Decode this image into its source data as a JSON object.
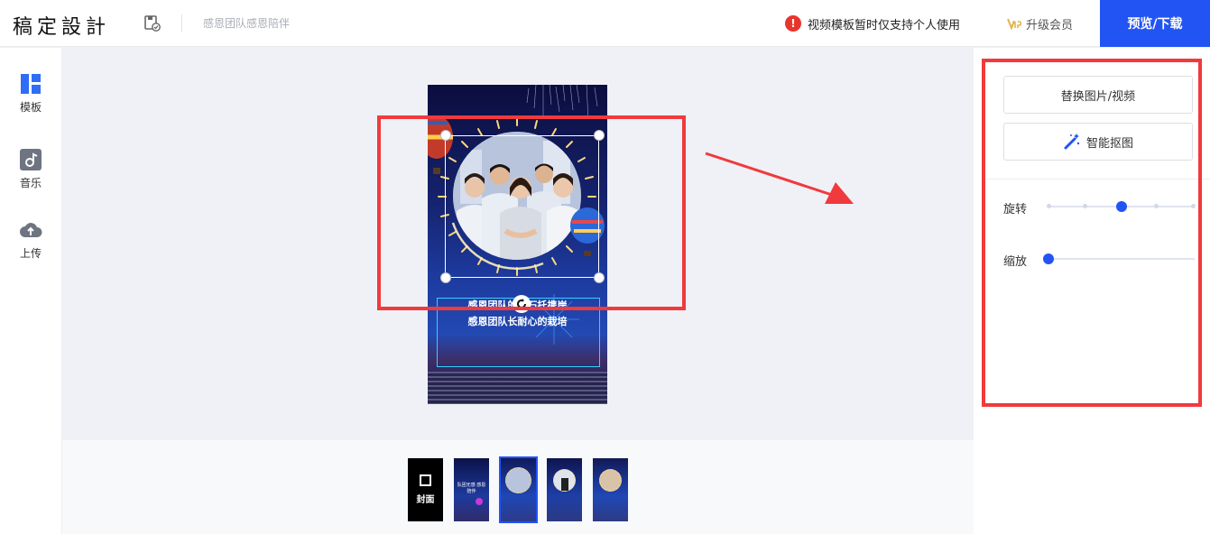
{
  "header": {
    "logo": "稿定設計",
    "doc_title": "感恩团队感恩陪伴",
    "notice": "视频模板暂时仅支持个人使用",
    "upgrade_label": "升级会员",
    "preview_label": "预览/下载"
  },
  "sidebar": {
    "items": [
      {
        "label": "模板"
      },
      {
        "label": "音乐"
      },
      {
        "label": "上传"
      }
    ]
  },
  "canvas": {
    "caption_line1": "感恩团队的一石托携岸",
    "caption_line2": "感恩团队长耐心的栽培"
  },
  "filmstrip": {
    "cover_label": "封面",
    "thumbs": [
      {
        "text": "队团无感 感恩陪伴"
      },
      {
        "text": ""
      },
      {
        "text": ""
      },
      {
        "text": ""
      }
    ]
  },
  "right_panel": {
    "replace_label": "替换图片/视频",
    "cutout_label": "智能抠图",
    "rotate_label": "旋转",
    "scale_label": "缩放",
    "rotate_value": 0.5,
    "scale_value": 0.0
  },
  "colors": {
    "accent": "#2254f4",
    "annotation": "#f03a3d",
    "warning": "#e8352c"
  }
}
